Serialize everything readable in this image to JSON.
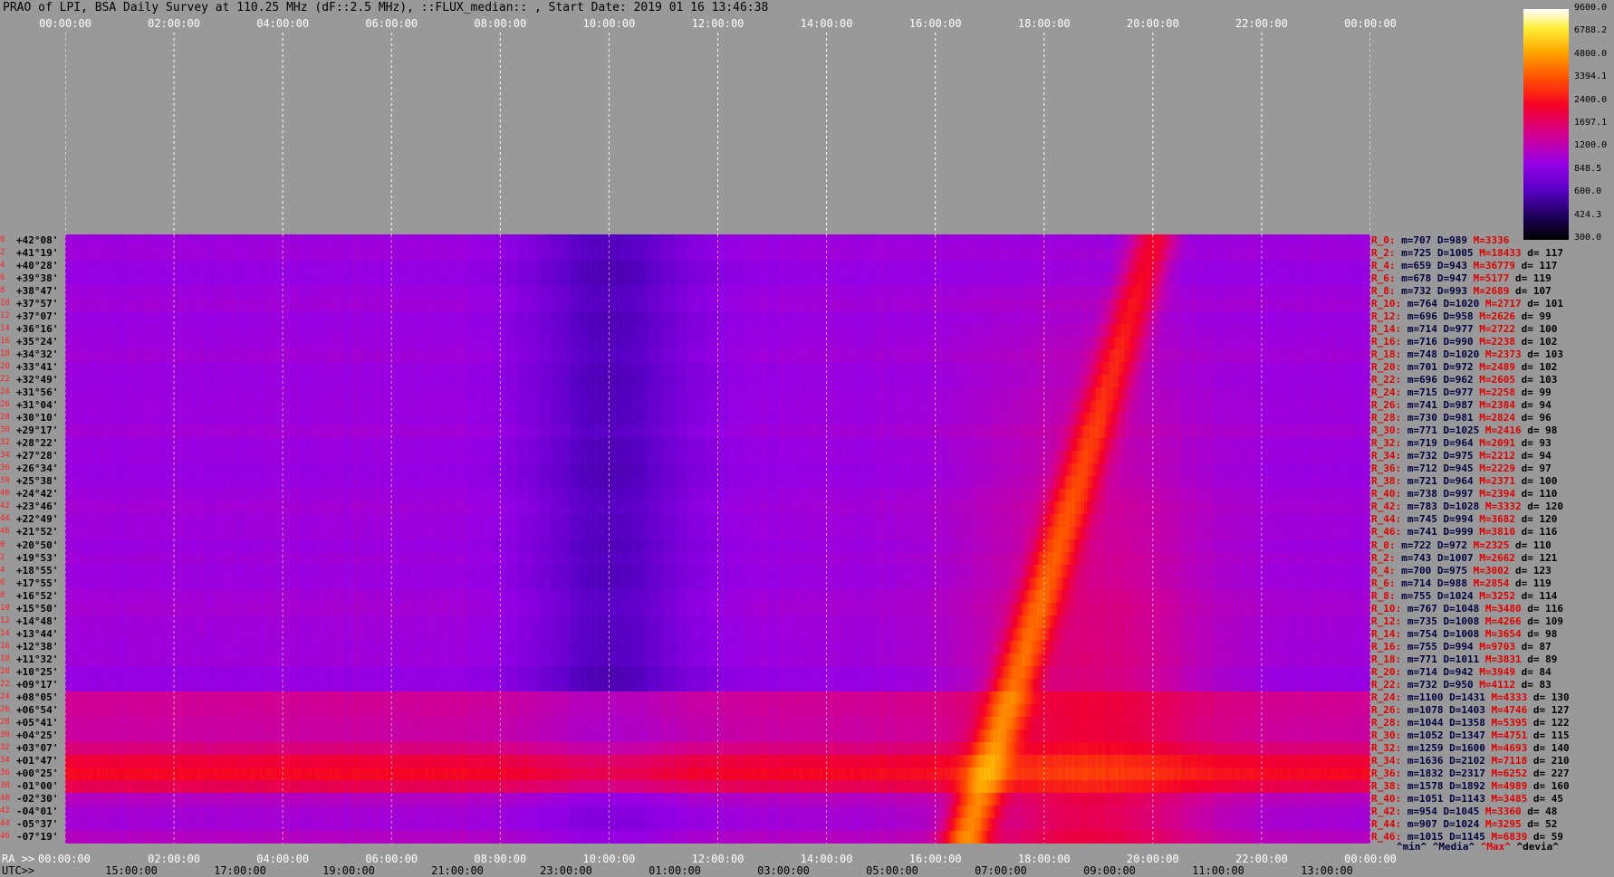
{
  "title": "PRAO of LPI, BSA Daily Survey at 110.25 MHz (dF::2.5 MHz), ::FLUX_median:: , Start Date: 2019 01 16 13:46:38",
  "chart_data": {
    "type": "heatmap",
    "title": "PRAO of LPI, BSA Daily Survey at 110.25 MHz (dF::2.5 MHz), ::FLUX_median:: , Start Date: 2019 01 16 13:46:38",
    "x_top_labels": [
      "00:00:00",
      "02:00:00",
      "04:00:00",
      "06:00:00",
      "08:00:00",
      "10:00:00",
      "12:00:00",
      "14:00:00",
      "16:00:00",
      "18:00:00",
      "20:00:00",
      "22:00:00",
      "00:00:00"
    ],
    "x_bottom_ra_prefix": "RA >>",
    "x_bottom_ra_labels": [
      "00:00:00",
      "02:00:00",
      "04:00:00",
      "06:00:00",
      "08:00:00",
      "10:00:00",
      "12:00:00",
      "14:00:00",
      "16:00:00",
      "18:00:00",
      "20:00:00",
      "22:00:00",
      "00:00:00"
    ],
    "x_bottom_utc_prefix": "UTC>>",
    "x_bottom_utc_labels": [
      "15:00:00",
      "17:00:00",
      "19:00:00",
      "21:00:00",
      "23:00:00",
      "01:00:00",
      "03:00:00",
      "05:00:00",
      "07:00:00",
      "09:00:00",
      "11:00:00",
      "13:00:00"
    ],
    "colorbar_ticks": [
      "9600.0",
      "6788.2",
      "4800.0",
      "3394.1",
      "2400.0",
      "1697.1",
      "1200.0",
      "848.5",
      "600.0",
      "424.3",
      "300.0"
    ],
    "colorbar_range": [
      300.0,
      9600.0
    ],
    "rows": [
      {
        "idx": "0",
        "dec": "+42°08'",
        "label": "R_0:",
        "m": "707",
        "D": "989",
        "M": "3336",
        "d": ""
      },
      {
        "idx": "2",
        "dec": "+41°19'",
        "label": "R_2:",
        "m": "725",
        "D": "1005",
        "M": "18433",
        "d": "117"
      },
      {
        "idx": "4",
        "dec": "+40°28'",
        "label": "R_4:",
        "m": "659",
        "D": "943",
        "M": "36779",
        "d": "117"
      },
      {
        "idx": "6",
        "dec": "+39°38'",
        "label": "R_6:",
        "m": "678",
        "D": "947",
        "M": "5177",
        "d": "119"
      },
      {
        "idx": "8",
        "dec": "+38°47'",
        "label": "R_8:",
        "m": "732",
        "D": "993",
        "M": "2689",
        "d": "107"
      },
      {
        "idx": "10",
        "dec": "+37°57'",
        "label": "R_10:",
        "m": "764",
        "D": "1020",
        "M": "2717",
        "d": "101"
      },
      {
        "idx": "12",
        "dec": "+37°07'",
        "label": "R_12:",
        "m": "696",
        "D": "958",
        "M": "2626",
        "d": "99"
      },
      {
        "idx": "14",
        "dec": "+36°16'",
        "label": "R_14:",
        "m": "714",
        "D": "977",
        "M": "2722",
        "d": "100"
      },
      {
        "idx": "16",
        "dec": "+35°24'",
        "label": "R_16:",
        "m": "716",
        "D": "990",
        "M": "2238",
        "d": "102"
      },
      {
        "idx": "18",
        "dec": "+34°32'",
        "label": "R_18:",
        "m": "748",
        "D": "1020",
        "M": "2373",
        "d": "103"
      },
      {
        "idx": "20",
        "dec": "+33°41'",
        "label": "R_20:",
        "m": "701",
        "D": "972",
        "M": "2489",
        "d": "102"
      },
      {
        "idx": "22",
        "dec": "+32°49'",
        "label": "R_22:",
        "m": "696",
        "D": "962",
        "M": "2605",
        "d": "103"
      },
      {
        "idx": "24",
        "dec": "+31°56'",
        "label": "R_24:",
        "m": "715",
        "D": "977",
        "M": "2258",
        "d": "99"
      },
      {
        "idx": "26",
        "dec": "+31°04'",
        "label": "R_26:",
        "m": "741",
        "D": "987",
        "M": "2384",
        "d": "94"
      },
      {
        "idx": "28",
        "dec": "+30°10'",
        "label": "R_28:",
        "m": "730",
        "D": "981",
        "M": "2824",
        "d": "96"
      },
      {
        "idx": "30",
        "dec": "+29°17'",
        "label": "R_30:",
        "m": "771",
        "D": "1025",
        "M": "2416",
        "d": "98"
      },
      {
        "idx": "32",
        "dec": "+28°22'",
        "label": "R_32:",
        "m": "719",
        "D": "964",
        "M": "2091",
        "d": "93"
      },
      {
        "idx": "34",
        "dec": "+27°28'",
        "label": "R_34:",
        "m": "732",
        "D": "975",
        "M": "2212",
        "d": "94"
      },
      {
        "idx": "36",
        "dec": "+26°34'",
        "label": "R_36:",
        "m": "712",
        "D": "945",
        "M": "2229",
        "d": "97"
      },
      {
        "idx": "38",
        "dec": "+25°38'",
        "label": "R_38:",
        "m": "721",
        "D": "964",
        "M": "2371",
        "d": "100"
      },
      {
        "idx": "40",
        "dec": "+24°42'",
        "label": "R_40:",
        "m": "738",
        "D": "997",
        "M": "2394",
        "d": "110"
      },
      {
        "idx": "42",
        "dec": "+23°46'",
        "label": "R_42:",
        "m": "783",
        "D": "1028",
        "M": "3332",
        "d": "120"
      },
      {
        "idx": "44",
        "dec": "+22°49'",
        "label": "R_44:",
        "m": "745",
        "D": "994",
        "M": "3682",
        "d": "120"
      },
      {
        "idx": "46",
        "dec": "+21°52'",
        "label": "R_46:",
        "m": "741",
        "D": "999",
        "M": "3810",
        "d": "116"
      },
      {
        "idx": "0",
        "dec": "+20°50'",
        "label": "R_0:",
        "m": "722",
        "D": "972",
        "M": "2325",
        "d": "110"
      },
      {
        "idx": "2",
        "dec": "+19°53'",
        "label": "R_2:",
        "m": "743",
        "D": "1007",
        "M": "2662",
        "d": "121"
      },
      {
        "idx": "4",
        "dec": "+18°55'",
        "label": "R_4:",
        "m": "700",
        "D": "975",
        "M": "3002",
        "d": "123"
      },
      {
        "idx": "6",
        "dec": "+17°55'",
        "label": "R_6:",
        "m": "714",
        "D": "988",
        "M": "2854",
        "d": "119"
      },
      {
        "idx": "8",
        "dec": "+16°52'",
        "label": "R_8:",
        "m": "755",
        "D": "1024",
        "M": "3252",
        "d": "114"
      },
      {
        "idx": "10",
        "dec": "+15°50'",
        "label": "R_10:",
        "m": "767",
        "D": "1048",
        "M": "3480",
        "d": "116"
      },
      {
        "idx": "12",
        "dec": "+14°48'",
        "label": "R_12:",
        "m": "735",
        "D": "1008",
        "M": "4266",
        "d": "109"
      },
      {
        "idx": "14",
        "dec": "+13°44'",
        "label": "R_14:",
        "m": "754",
        "D": "1008",
        "M": "3654",
        "d": "98"
      },
      {
        "idx": "16",
        "dec": "+12°38'",
        "label": "R_16:",
        "m": "755",
        "D": "994",
        "M": "9703",
        "d": "87"
      },
      {
        "idx": "18",
        "dec": "+11°32'",
        "label": "R_18:",
        "m": "771",
        "D": "1011",
        "M": "3831",
        "d": "89"
      },
      {
        "idx": "20",
        "dec": "+10°25'",
        "label": "R_20:",
        "m": "714",
        "D": "942",
        "M": "3949",
        "d": "84"
      },
      {
        "idx": "22",
        "dec": "+09°17'",
        "label": "R_22:",
        "m": "732",
        "D": "950",
        "M": "4112",
        "d": "83"
      },
      {
        "idx": "24",
        "dec": "+08°05'",
        "label": "R_24:",
        "m": "1100",
        "D": "1431",
        "M": "4333",
        "d": "130"
      },
      {
        "idx": "26",
        "dec": "+06°54'",
        "label": "R_26:",
        "m": "1078",
        "D": "1403",
        "M": "4746",
        "d": "127"
      },
      {
        "idx": "28",
        "dec": "+05°41'",
        "label": "R_28:",
        "m": "1044",
        "D": "1358",
        "M": "5395",
        "d": "122"
      },
      {
        "idx": "30",
        "dec": "+04°25'",
        "label": "R_30:",
        "m": "1052",
        "D": "1347",
        "M": "4751",
        "d": "115"
      },
      {
        "idx": "32",
        "dec": "+03°07'",
        "label": "R_32:",
        "m": "1259",
        "D": "1600",
        "M": "4693",
        "d": "140"
      },
      {
        "idx": "34",
        "dec": "+01°47'",
        "label": "R_34:",
        "m": "1636",
        "D": "2102",
        "M": "7118",
        "d": "210"
      },
      {
        "idx": "36",
        "dec": "+00°25'",
        "label": "R_36:",
        "m": "1832",
        "D": "2317",
        "M": "6252",
        "d": "227"
      },
      {
        "idx": "38",
        "dec": "-01°00'",
        "label": "R_38:",
        "m": "1578",
        "D": "1892",
        "M": "4989",
        "d": "160"
      },
      {
        "idx": "40",
        "dec": "-02°30'",
        "label": "R_40:",
        "m": "1051",
        "D": "1143",
        "M": "3485",
        "d": "45"
      },
      {
        "idx": "42",
        "dec": "-04°01'",
        "label": "R_42:",
        "m": "954",
        "D": "1045",
        "M": "3360",
        "d": "48"
      },
      {
        "idx": "44",
        "dec": "-05°37'",
        "label": "R_44:",
        "m": "907",
        "D": "1024",
        "M": "3295",
        "d": "52"
      },
      {
        "idx": "46",
        "dec": "-07°19'",
        "label": "R_46:",
        "m": "1015",
        "D": "1145",
        "M": "6839",
        "d": "59"
      }
    ],
    "legend": {
      "min": "^min^",
      "median": "^Media^",
      "max": "^Max^",
      "dev": "^devia^"
    }
  },
  "colors": {
    "background": "#999999",
    "title": "#000000",
    "grid": "#ffffff",
    "label_red": "#e00000",
    "label_dark": "#000040"
  }
}
